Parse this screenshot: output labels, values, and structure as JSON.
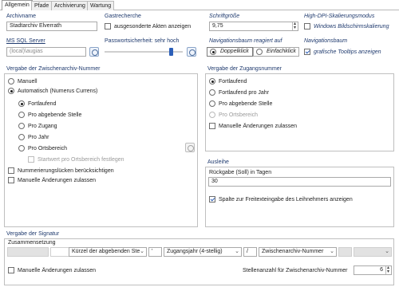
{
  "tabs": [
    {
      "label": "Allgemein"
    },
    {
      "label": "Pfade"
    },
    {
      "label": "Archivierung"
    },
    {
      "label": "Wartung"
    }
  ],
  "archive": {
    "label": "Archivname",
    "value": "Stadtarchiv Elverrath"
  },
  "gastrecherche": {
    "label": "Gastrecherche",
    "checkbox_label": "ausgesonderte Akten anzeigen",
    "checked": false
  },
  "font": {
    "label": "Schriftgröße",
    "value": "9,75"
  },
  "hidpi": {
    "label": "High-DPI-Skalierungsmodus",
    "checkbox_label": "Windows Bildschirmskalierung",
    "checked": false
  },
  "sql": {
    "label": "MS SQL Server",
    "value": "(local)\\augias"
  },
  "password": {
    "label": "Passwortsicherheit: sehr hoch",
    "level_percent": 85
  },
  "navtree_react": {
    "label": "Navigationsbaum reagiert auf",
    "option1": "Doppelklick",
    "option2": "Einfachklick",
    "selected": "Doppelklick"
  },
  "navtree": {
    "label": "Navigationsbaum",
    "checkbox_label": "grafische Tooltips anzeigen",
    "checked": true
  },
  "zwischenarchiv": {
    "title": "Vergabe der Zwischenarchiv-Nummer",
    "manuell": "Manuell",
    "automatisch": "Automatisch  (Numerus Currens)",
    "fortlaufend": "Fortlaufend",
    "pro_abgebende_stelle": "Pro abgebende Stelle",
    "pro_zugang": "Pro Zugang",
    "pro_jahr": "Pro Jahr",
    "pro_ortsbereich": "Pro Ortsbereich",
    "startwert": "Startwert pro Ortsbereich festlegen",
    "luecken": "Nummerierungslücken berücksichtigen",
    "manuelle_aenderungen": "Manuelle Änderungen zulassen"
  },
  "zugangsnummer": {
    "title": "Vergabe der Zugangsnummer",
    "fortlaufend": "Fortlaufend",
    "fortlaufend_pro_jahr": "Fortlaufend pro Jahr",
    "pro_abgebende_stelle": "Pro abgebende Stelle",
    "pro_ortsbereich": "Pro Ortsbereich",
    "manuelle_aenderungen": "Manuelle Änderungen zulassen"
  },
  "ausleihe": {
    "title": "Ausleihe",
    "rueckgabe_label": "Rückgabe (Soll) in Tagen",
    "rueckgabe_value": "30",
    "spalte_label": "Spalte zur Freitexteingabe des Leihnehmers anzeigen",
    "spalte_checked": true
  },
  "signatur": {
    "title": "Vergabe der Signatur",
    "zusammensetzung": "Zusammensetzung",
    "dd1": "Kürzel der abgebenden Ste",
    "sep1": "'",
    "dd2": "Zugangsjahr (4-stellig)",
    "sep2": "/",
    "dd3": "Zwischenarchiv-Nummer",
    "manuelle_aenderungen": "Manuelle Änderungen zulassen",
    "stellenanzahl_label": "Stellenanzahl für Zwischenarchiv-Nummer",
    "stellenanzahl_value": "6"
  },
  "colors": {
    "accent": "#2c5fb8",
    "label_blue": "#1f3a6e"
  }
}
